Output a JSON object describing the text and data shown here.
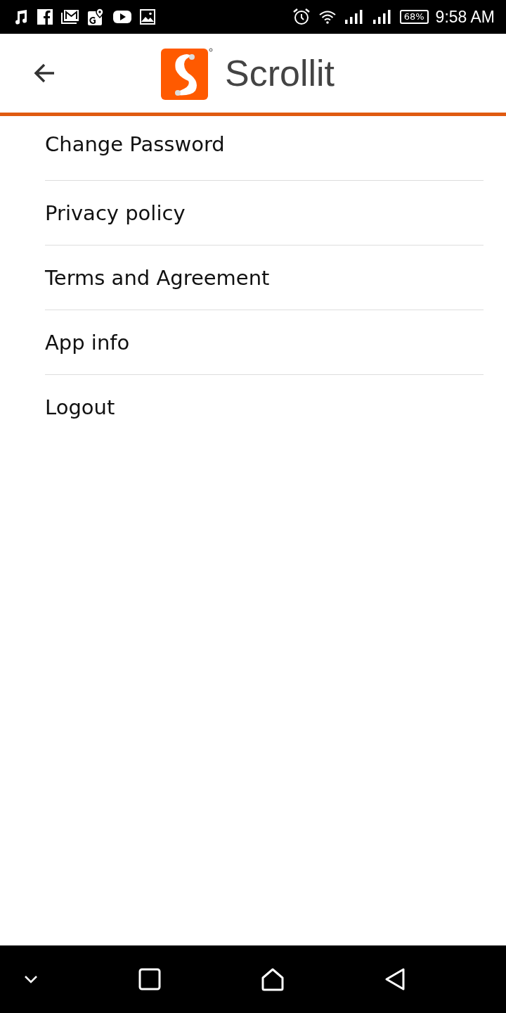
{
  "status_bar": {
    "battery": "68%",
    "time": "9:58 AM"
  },
  "header": {
    "title": "Scrollit"
  },
  "menu": [
    {
      "label": "Change Password"
    },
    {
      "label": "Privacy policy"
    },
    {
      "label": "Terms and Agreement"
    },
    {
      "label": "App info"
    },
    {
      "label": "Logout"
    }
  ]
}
